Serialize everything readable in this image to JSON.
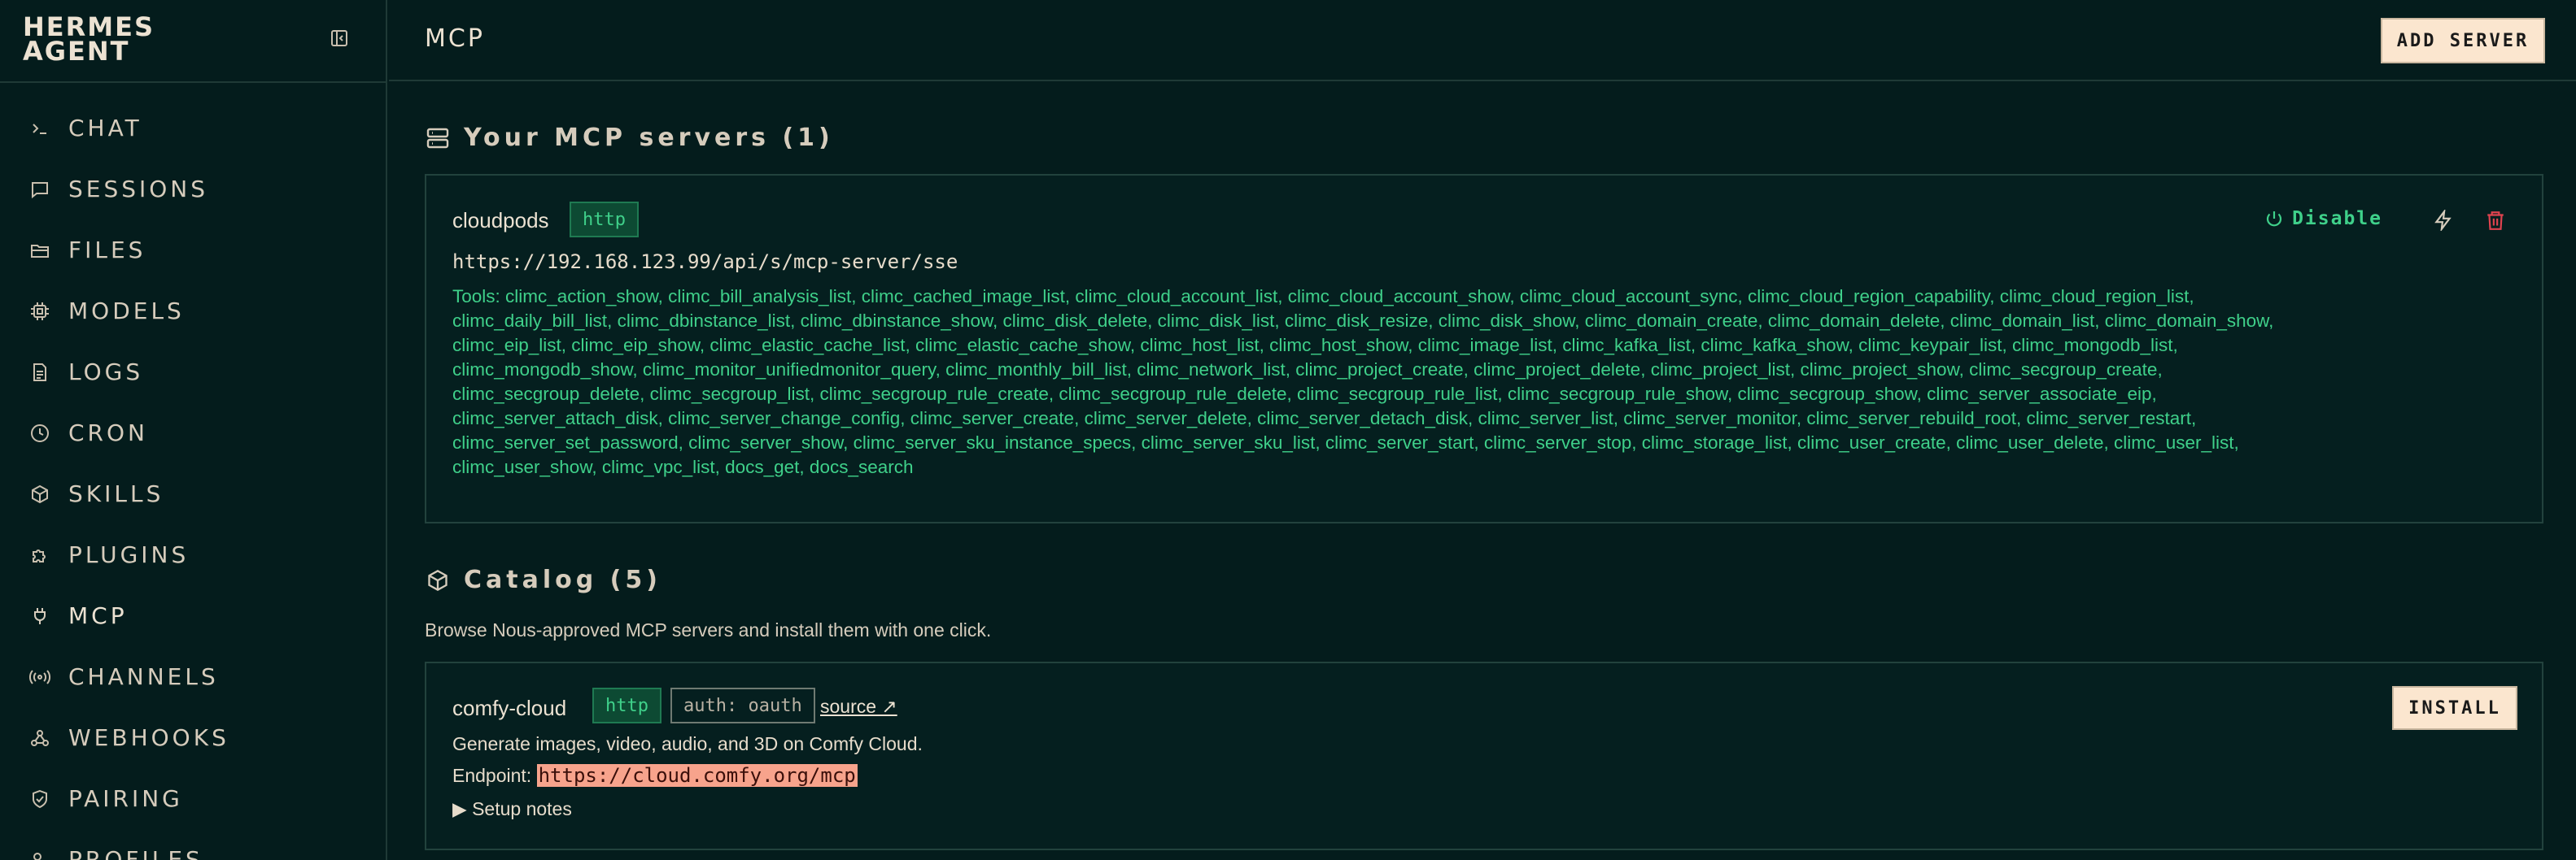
{
  "app": {
    "brand_line1": "HERMES",
    "brand_line2": "AGENT"
  },
  "sidebar": {
    "items": [
      {
        "label": "CHAT",
        "icon": "terminal-prompt-icon"
      },
      {
        "label": "SESSIONS",
        "icon": "message-square-icon"
      },
      {
        "label": "FILES",
        "icon": "folder-open-icon"
      },
      {
        "label": "MODELS",
        "icon": "cpu-chip-icon"
      },
      {
        "label": "LOGS",
        "icon": "file-text-icon"
      },
      {
        "label": "CRON",
        "icon": "clock-icon"
      },
      {
        "label": "SKILLS",
        "icon": "package-icon"
      },
      {
        "label": "PLUGINS",
        "icon": "puzzle-icon"
      },
      {
        "label": "MCP",
        "icon": "plug-icon"
      },
      {
        "label": "CHANNELS",
        "icon": "radio-broadcast-icon"
      },
      {
        "label": "WEBHOOKS",
        "icon": "webhook-icon"
      },
      {
        "label": "PAIRING",
        "icon": "shield-check-icon"
      },
      {
        "label": "PROFILES",
        "icon": "users-icon"
      }
    ]
  },
  "header": {
    "title": "MCP",
    "add_button": "ADD SERVER"
  },
  "servers_section": {
    "title": "Your MCP servers (1)",
    "server": {
      "name": "cloudpods",
      "transport": "http",
      "url": "https://192.168.123.99/api/s/mcp-server/sse",
      "disable_label": "Disable",
      "tools_text": "Tools: climc_action_show, climc_bill_analysis_list, climc_cached_image_list, climc_cloud_account_list, climc_cloud_account_show, climc_cloud_account_sync, climc_cloud_region_capability, climc_cloud_region_list, climc_daily_bill_list, climc_dbinstance_list, climc_dbinstance_show, climc_disk_delete, climc_disk_list, climc_disk_resize, climc_disk_show, climc_domain_create, climc_domain_delete, climc_domain_list, climc_domain_show, climc_eip_list, climc_eip_show, climc_elastic_cache_list, climc_elastic_cache_show, climc_host_list, climc_host_show, climc_image_list, climc_kafka_list, climc_kafka_show, climc_keypair_list, climc_mongodb_list, climc_mongodb_show, climc_monitor_unifiedmonitor_query, climc_monthly_bill_list, climc_network_list, climc_project_create, climc_project_delete, climc_project_list, climc_project_show, climc_secgroup_create, climc_secgroup_delete, climc_secgroup_list, climc_secgroup_rule_create, climc_secgroup_rule_delete, climc_secgroup_rule_list, climc_secgroup_rule_show, climc_secgroup_show, climc_server_associate_eip, climc_server_attach_disk, climc_server_change_config, climc_server_create, climc_server_delete, climc_server_detach_disk, climc_server_list, climc_server_monitor, climc_server_rebuild_root, climc_server_restart, climc_server_set_password, climc_server_show, climc_server_sku_instance_specs, climc_server_sku_list, climc_server_start, climc_server_stop, climc_storage_list, climc_user_create, climc_user_delete, climc_user_list, climc_user_show, climc_vpc_list, docs_get, docs_search"
    }
  },
  "catalog_section": {
    "title": "Catalog (5)",
    "description": "Browse Nous-approved MCP servers and install them with one click.",
    "item": {
      "name": "comfy-cloud",
      "transport": "http",
      "auth": "auth: oauth",
      "source_label": "source ↗",
      "description": "Generate images, video, audio, and 3D on Comfy Cloud.",
      "endpoint_label": "Endpoint:",
      "endpoint": "https://cloud.comfy.org/mcp",
      "setup_notes": "▶ Setup notes",
      "install_label": "INSTALL"
    }
  },
  "colors": {
    "background": "#041c1c",
    "accent_green": "#3fd08a",
    "danger_red": "#e0434f",
    "button_cream": "#fbe6cf",
    "endpoint_highlight": "#f7a38c"
  }
}
